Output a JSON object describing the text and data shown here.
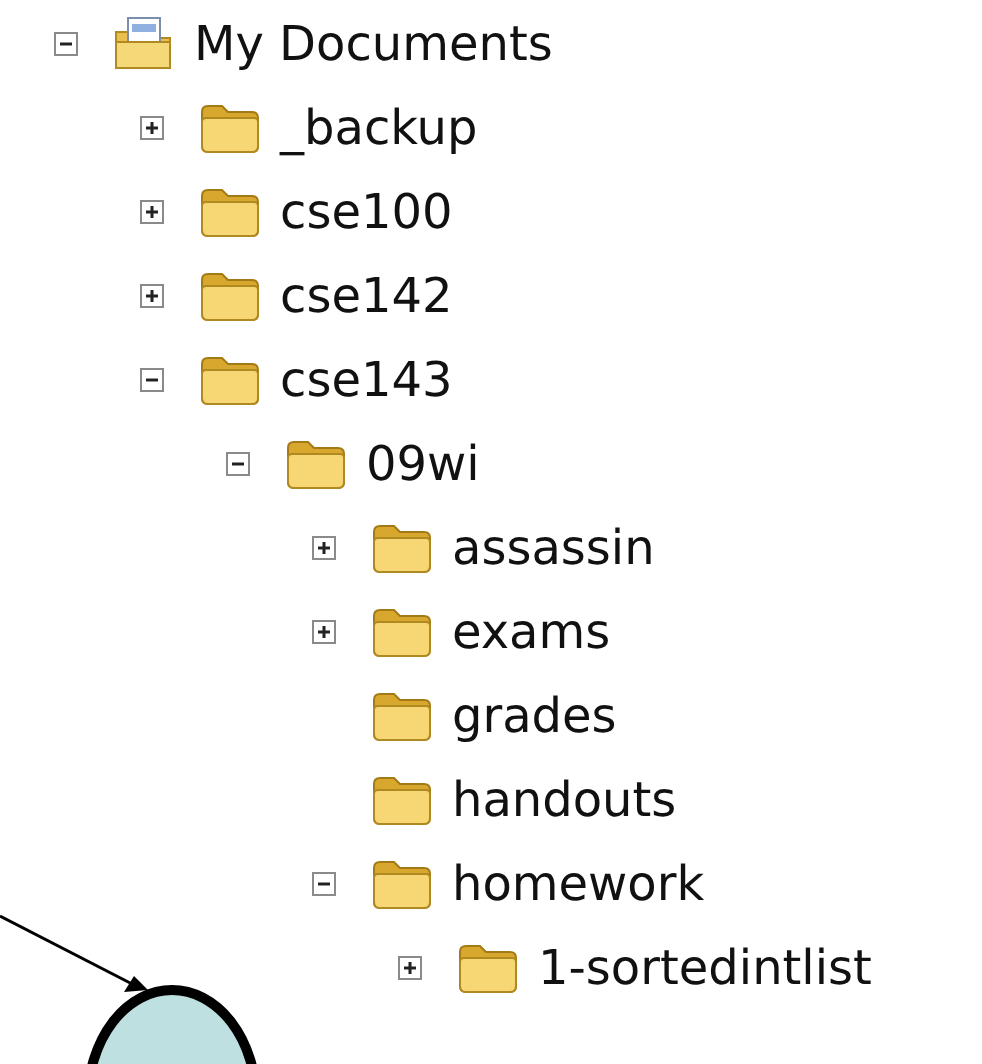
{
  "tree": [
    {
      "label": "My Documents",
      "kind": "documents",
      "expandable": true,
      "expanded": true,
      "children": [
        {
          "label": "_backup",
          "kind": "folder",
          "expandable": true,
          "expanded": false
        },
        {
          "label": "cse100",
          "kind": "folder",
          "expandable": true,
          "expanded": false
        },
        {
          "label": "cse142",
          "kind": "folder",
          "expandable": true,
          "expanded": false
        },
        {
          "label": "cse143",
          "kind": "folder",
          "expandable": true,
          "expanded": true,
          "children": [
            {
              "label": "09wi",
              "kind": "folder",
              "expandable": true,
              "expanded": true,
              "children": [
                {
                  "label": "assassin",
                  "kind": "folder",
                  "expandable": true,
                  "expanded": false
                },
                {
                  "label": "exams",
                  "kind": "folder",
                  "expandable": true,
                  "expanded": false
                },
                {
                  "label": "grades",
                  "kind": "folder",
                  "expandable": false
                },
                {
                  "label": "handouts",
                  "kind": "folder",
                  "expandable": false
                },
                {
                  "label": "homework",
                  "kind": "folder",
                  "expandable": true,
                  "expanded": true,
                  "children": [
                    {
                      "label": "1-sortedintlist",
                      "kind": "folder",
                      "expandable": true,
                      "expanded": false
                    }
                  ]
                }
              ]
            }
          ]
        }
      ]
    }
  ]
}
